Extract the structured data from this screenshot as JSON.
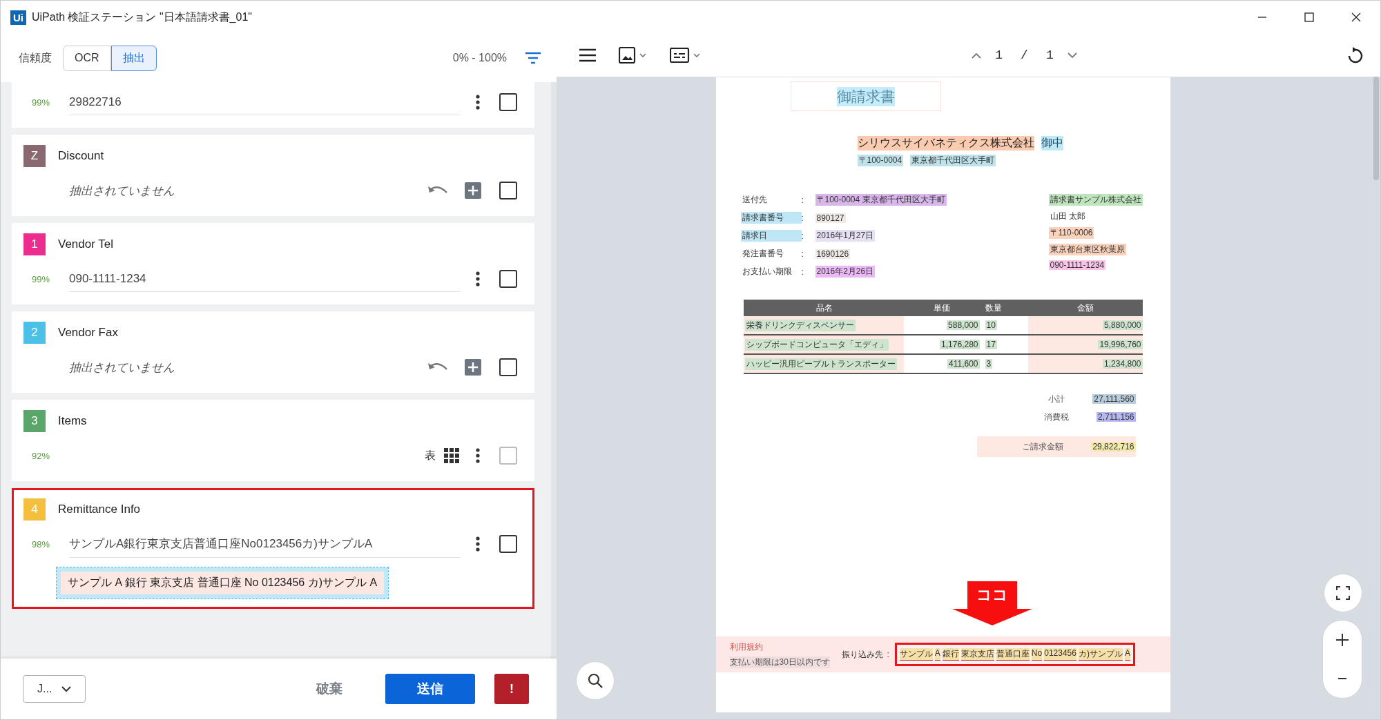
{
  "window": {
    "logo": "Ui",
    "title": "UiPath 検証ステーション \"日本語請求書_01\""
  },
  "toolbar": {
    "label": "信頼度",
    "tabs": [
      {
        "label": "OCR",
        "selected": false
      },
      {
        "label": "抽出",
        "selected": true
      }
    ],
    "range": "0% - 100%"
  },
  "fields": [
    {
      "kind": "value",
      "confidence": "99%",
      "value": "29822716",
      "checked": false,
      "disabled": false,
      "annotated": false
    },
    {
      "badge": "Z",
      "color": "#8a6870",
      "name": "Discount",
      "kind": "empty",
      "text": "抽出されていません",
      "checked": false,
      "disabled": false,
      "annotated": false
    },
    {
      "badge": "1",
      "color": "#ec2d8f",
      "name": "Vendor Tel",
      "kind": "value",
      "confidence": "99%",
      "value": "090-1111-1234",
      "checked": false,
      "disabled": false,
      "annotated": false
    },
    {
      "badge": "2",
      "color": "#4cc0e6",
      "name": "Vendor Fax",
      "kind": "empty",
      "text": "抽出されていません",
      "checked": false,
      "disabled": false,
      "annotated": false
    },
    {
      "badge": "3",
      "color": "#5aa56a",
      "name": "Items",
      "kind": "table",
      "confidence": "92%",
      "text": "表",
      "checked": false,
      "disabled": true,
      "annotated": false
    },
    {
      "badge": "4",
      "color": "#f4bf3c",
      "name": "Remittance Info",
      "kind": "value",
      "confidence": "98%",
      "value": "サンプルA銀行東京支店普通口座No0123456カ)サンプルA",
      "snippet": "サンプル A 銀行 東京支店 普通口座 No 0123456 カ)サンプル A",
      "checked": false,
      "disabled": false,
      "annotated": true
    }
  ],
  "footer": {
    "dropdown": "J...",
    "discard": "破棄",
    "submit": "送信",
    "alert": "!"
  },
  "viewer": {
    "page": "1",
    "separator": "/",
    "total": "1"
  },
  "document": {
    "title": "御請求書",
    "recipient": [
      {
        "kind": "name",
        "text": "シリウスサイバネティクス株式会社",
        "color": "#fbcbb0"
      },
      {
        "kind": "name",
        "text": "御中",
        "color": "#bfe9f7"
      },
      {
        "kind": "address",
        "text": "〒100-0004",
        "color": "#bfe2ea"
      },
      {
        "kind": "address",
        "text": "東京都千代田区大手町",
        "color": "#bfe2ea"
      }
    ],
    "details": [
      {
        "label": {
          "text": "送付先"
        },
        "sep": ":",
        "value": "〒100-0004 東京都千代田区大手町",
        "color": "#d8b6ec"
      },
      {
        "label": {
          "text": "請求書番号",
          "color": "#bfe6f7"
        },
        "sep": ":",
        "value": "890127",
        "color": "#efe9e6"
      },
      {
        "label": {
          "text": "請求日",
          "color": "#bfe6f7"
        },
        "sep": ":",
        "value": "2016年1月27日",
        "color": "#e6e0f4"
      },
      {
        "label": {
          "text": "発注書番号"
        },
        "sep": ":",
        "value": "1690126",
        "color": "#efe9e6"
      },
      {
        "label": {
          "text": "お支払い期限"
        },
        "sep": ":",
        "value": "2016年2月26日",
        "color": "#eab8f5"
      }
    ],
    "sender": [
      {
        "text": "請求書サンプル株式会社",
        "color": "#bfe5bf"
      },
      {
        "text": "山田 太郎"
      },
      {
        "text": "〒110-0006",
        "color": "#fbd3bd"
      },
      {
        "text": "東京都台東区秋葉原",
        "color": "#fbd3bd"
      },
      {
        "text": "090-1111-1234",
        "color": "#f7c3e6"
      }
    ],
    "table": {
      "columns": [
        "品名",
        "単価",
        "数量",
        "金額"
      ],
      "rows": [
        [
          "栄養ドリンクディスペンサー",
          "588,000",
          "10",
          "5,880,000"
        ],
        [
          "シップボードコンピュータ「エディ」",
          "1,176,280",
          "17",
          "19,996,760"
        ],
        [
          "ハッピー汎用ピープルトランスポーター",
          "411,600",
          "3",
          "1,234,800"
        ]
      ]
    },
    "totals": [
      {
        "label": "小計",
        "value": "27,111,560",
        "color": "#b8cddc",
        "emphasis": false
      },
      {
        "label": "消費税",
        "value": "2,711,156",
        "color": "#b4b8ee",
        "emphasis": false
      },
      {
        "label": "ご請求金額",
        "value": "29,822,716",
        "color": "#f3e9ad",
        "emphasis": true
      }
    ],
    "notes": {
      "title": "利用規約",
      "text": "支払い期限は30日以内です",
      "payee_label": "振り込み先",
      "sep": ":",
      "payee": [
        "サンプル",
        "A",
        "銀行",
        "東京支店",
        "普通口座",
        "No",
        "0123456",
        "カ)サンプル",
        "A"
      ],
      "annotated": true
    }
  },
  "callout": {
    "label": "ココ"
  }
}
